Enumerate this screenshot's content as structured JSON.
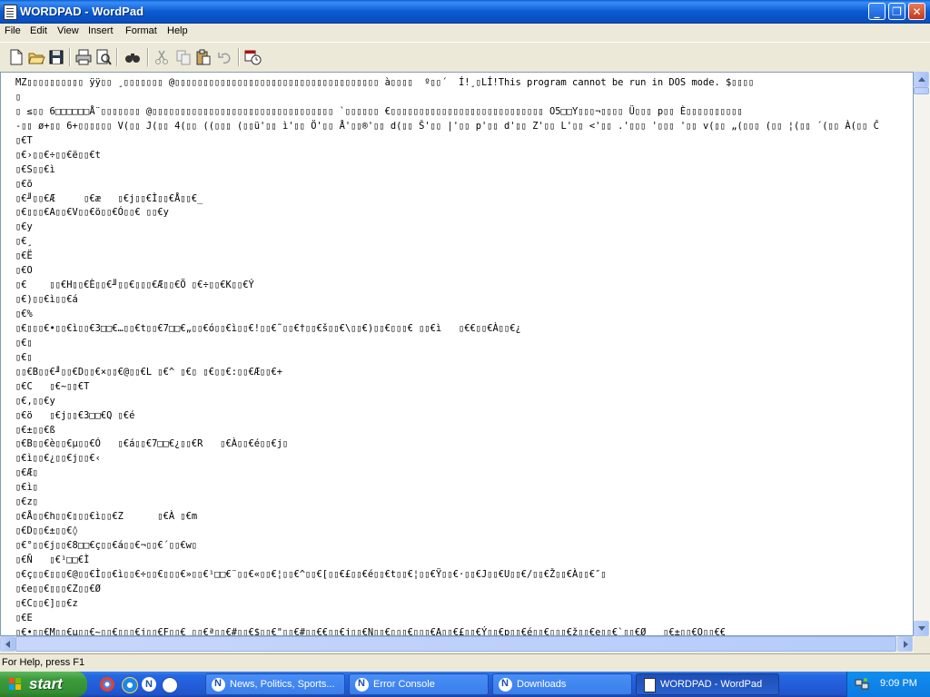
{
  "window": {
    "title": "WORDPAD - WordPad"
  },
  "menubar": {
    "items": [
      "File",
      "Edit",
      "View",
      "Insert",
      "Format",
      "Help"
    ]
  },
  "toolbar": {
    "buttons": [
      "new-icon",
      "open-icon",
      "save-icon",
      "print-icon",
      "print-preview-icon",
      "find-icon",
      "cut-icon",
      "copy-icon",
      "paste-icon",
      "undo-icon",
      "date-time-icon"
    ]
  },
  "document": {
    "lines": [
      "MZ▯▯▯▯▯▯▯▯▯▯ ÿÿ▯▯ ¸▯▯▯▯▯▯▯ @▯▯▯▯▯▯▯▯▯▯▯▯▯▯▯▯▯▯▯▯▯▯▯▯▯▯▯▯▯▯▯▯▯▯▯▯ à▯▯▯▯  º▯▯´  Í!¸▯LÍ!This program cannot be run in DOS mode. $▯▯▯▯",
      "▯",
      "▯ ≤▯▯ 6□□□□□□Å¨▯▯▯▯▯▯▯ @▯▯▯▯▯▯▯▯▯▯▯▯▯▯▯▯▯▯▯▯▯▯▯▯▯▯▯▯▯▯▯▯ `▯▯▯▯▯▯ €▯▯▯▯▯▯▯▯▯▯▯▯▯▯▯▯▯▯▯▯▯▯▯▯▯▯▯ O5□□Y▯▯▯¬▯▯▯▯ Ü▯▯▯ p▯▯ È▯▯▯▯▯▯▯▯▯▯",
      "-▯▯ ø+▯▯ 6+▯▯▯▯▯▯ V(▯▯ J(▯▯ 4(▯▯ ((▯▯▯ (▯▯ü'▯▯ ì'▯▯ Ö'▯▯ Å'▯▯®'▯▯ d(▯▯ Š'▯▯ |'▯▯ p'▯▯ d'▯▯ Z'▯▯ L'▯▯ <'▯▯ .'▯▯▯ '▯▯▯ '▯▯ v(▯▯ „(▯▯▯ (▯▯ ¦(▯▯ ´(▯▯ À(▯▯ Ĉ",
      "▯€T",
      "▯€›▯▯€÷▯▯€ë▯▯€t",
      "▯€S▯▯€ì",
      "▯€õ",
      "▯€╜▯▯€Æ     ▯€æ   ▯€j▯▯€Ì▯▯€Å▯▯€_",
      "▯€▯▯▯€A▯▯€V▯▯€ö▯▯€Ó▯▯€ ▯▯€y",
      "▯€y",
      "▯€¸",
      "▯€Ë",
      "▯€O",
      "▯€    ▯▯€H▯▯€È▯▯€╜▯▯€▯▯▯€Æ▯▯€Ö ▯€÷▯▯€K▯▯€Ý",
      "▯€)▯▯€ì▯▯€á",
      "▯€%",
      "▯€▯▯▯€•▯▯€ì▯▯€3□□€…▯▯€t▯▯€7□□€„▯▯€ó▯▯€ì▯▯€!▯▯€˜▯▯€†▯▯€š▯▯€\\▯▯€)▯▯€▯▯▯€ ▯▯€ì   ▯€€▯▯€À▯▯€¿",
      "▯€▯",
      "▯€▯",
      "▯▯€B▯▯€╜▯▯€D▯▯€×▯▯€@▯▯€L ▯€^ ▯€▯ ▯€▯▯€:▯▯€Æ▯▯€+",
      "▯€C   ▯€~▯▯€T",
      "▯€,▯▯€y",
      "▯€ö   ▯€j▯▯€3□□€Q ▯€é",
      "▯€±▯▯€ß",
      "▯€B▯▯€è▯▯€µ▯▯€Ó   ▯€á▯▯€7□□€¿▯▯€R   ▯€À▯▯€é▯▯€j▯",
      "▯€ì▯▯€¿▯▯€j▯▯€‹",
      "▯€Æ▯",
      "▯€ì▯",
      "▯€z▯",
      "▯€Å▯▯€h▯▯€▯▯▯€ì▯▯€Z      ▯€À ▯€m",
      "▯€D▯▯€±▯▯€◊",
      "▯€°▯▯€j▯▯€8□□€ç▯▯€á▯▯€¬▯▯€´▯▯€w▯",
      "▯€Ñ   ▯€¹□□€Ì",
      "▯€ç▯▯€▯▯▯€@▯▯€Ì▯▯€ì▯▯€÷▯▯€▯▯▯€»▯▯€¹□□€¨▯▯€«▯▯€¦▯▯€^▯▯€[▯▯€£▯▯€é▯▯€t▯▯€¦▯▯€Ÿ▯▯€·▯▯€J▯▯€U▯▯€/▯▯€Ž▯▯€À▯▯€″▯",
      "▯€e▯▯€▯▯▯€Z▯▯€Ø",
      "▯€C▯▯€]▯▯€z",
      "▯€E",
      "▯€•▯▯€M▯▯€µ▯▯€~▯▯€▯▯▯€j▯▯€F▯▯€ ▯▯€ª▯▯€#▯▯€$▯▯€\"▯▯€#▯▯€€▯▯€j▯▯€N▯▯€▯▯▯€▯▯▯€A▯▯€£▯▯€Ý▯▯€p▯▯€é▯▯€▯▯▯€ž▯▯€e▯▯€`▯▯€Ø   ▯€±▯▯€O▯▯€€"
    ]
  },
  "statusbar": {
    "text": "For Help, press F1"
  },
  "taskbar": {
    "start_label": "start",
    "tasks": [
      {
        "label": "News, Politics, Sports..."
      },
      {
        "label": "Error Console"
      },
      {
        "label": "Downloads"
      },
      {
        "label": "WORDPAD - WordPad"
      }
    ],
    "clock": "9:09 PM"
  },
  "colors": {
    "titlebar": "#0b5ad2",
    "taskbar": "#245edc",
    "start_button": "#3c9b3c",
    "window_bg": "#ece9d8"
  }
}
